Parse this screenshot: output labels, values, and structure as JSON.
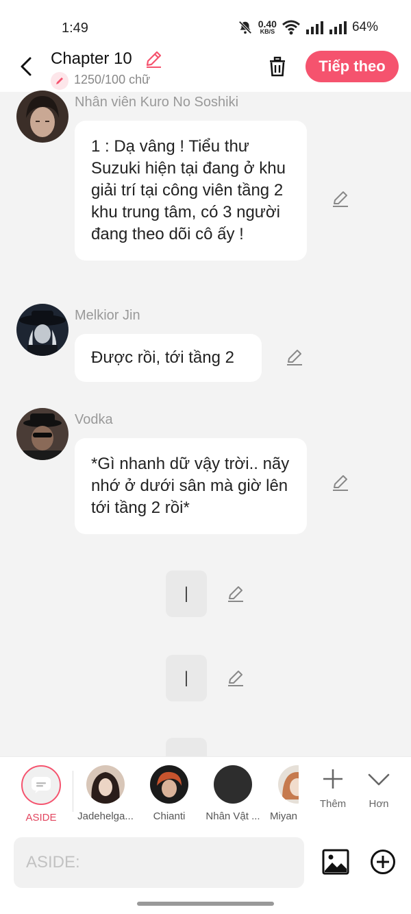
{
  "status_bar": {
    "time": "1:49",
    "net_speed_value": "0.40",
    "net_speed_unit": "KB/S",
    "battery": "64%"
  },
  "header": {
    "title": "Chapter 10",
    "word_count": "1250/100 chữ",
    "next_label": "Tiếp theo"
  },
  "messages": [
    {
      "sender": "Nhân viên Kuro No Soshiki",
      "text": "1 : Dạ vâng ! Tiểu thư Suzuki hiện tại đang ở khu giải trí tại công viên tầng 2 khu trung tâm, có 3 người đang theo dõi cô ấy !"
    },
    {
      "sender": "Melkior Jin",
      "text": "Được rồi, tới tầng 2"
    },
    {
      "sender": "Vodka",
      "text": "*Gì nhanh dữ vậy trời.. nãy nhớ ở dưới sân mà giờ lên tới tầng 2 rồi*"
    }
  ],
  "aside_lines": [
    "|",
    "|"
  ],
  "characters": [
    {
      "name": "ASIDE"
    },
    {
      "name": "Jadehelga..."
    },
    {
      "name": "Chianti"
    },
    {
      "name": "Nhân Vật ..."
    },
    {
      "name": "Miyan"
    }
  ],
  "tools": {
    "add_label": "Thêm",
    "more_label": "Hơn"
  },
  "input": {
    "placeholder": "ASIDE:"
  },
  "colors": {
    "accent": "#f5536e",
    "background": "#f3f3f3",
    "bubble": "#ffffff"
  }
}
